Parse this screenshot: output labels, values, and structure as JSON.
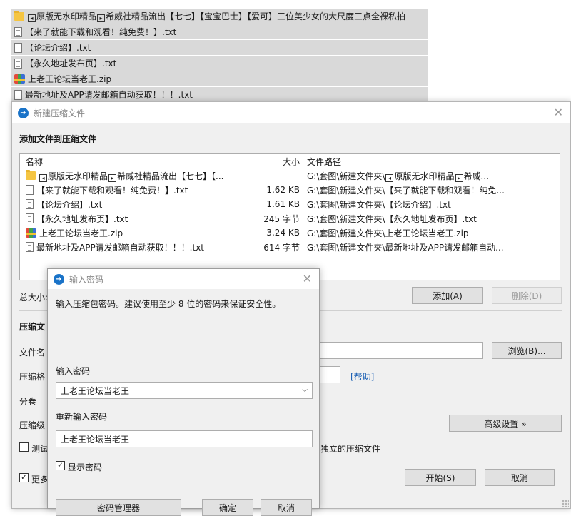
{
  "background_files": [
    {
      "icon": "folder-icon",
      "parts": [
        "",
        "原版无水印精品",
        "希威社精品流出【七七】【宝宝巴士】【爱可】三位美少女的大尺度三点全裸私拍"
      ]
    },
    {
      "icon": "txt-file-icon",
      "name": "【来了就能下载和观看！纯免费！】.txt"
    },
    {
      "icon": "txt-file-icon",
      "name": "【论坛介绍】.txt"
    },
    {
      "icon": "txt-file-icon",
      "name": "【永久地址发布页】.txt"
    },
    {
      "icon": "zip-archive-icon",
      "name": "上老王论坛当老王.zip"
    },
    {
      "icon": "txt-file-icon",
      "name": "最新地址及APP请发邮箱自动获取！！！.txt"
    }
  ],
  "main_dialog": {
    "title": "新建压缩文件",
    "section_title": "添加文件到压缩文件",
    "columns": {
      "name": "名称",
      "size": "大小",
      "path": "文件路径"
    },
    "files": [
      {
        "icon": "folder-icon",
        "name_parts": [
          "原版无水印精品",
          "希威社精品流出【七七】【..."
        ],
        "size": "",
        "path_parts": [
          "G:\\套图\\新建文件夹\\",
          "原版无水印精品",
          "希威..."
        ]
      },
      {
        "icon": "txt-file-icon",
        "name": "【来了就能下载和观看！纯免费！】.txt",
        "size": "1.62 KB",
        "path": "G:\\套图\\新建文件夹\\【来了就能下载和观看！纯免..."
      },
      {
        "icon": "txt-file-icon",
        "name": "【论坛介绍】.txt",
        "size": "1.61 KB",
        "path": "G:\\套图\\新建文件夹\\【论坛介绍】.txt"
      },
      {
        "icon": "txt-file-icon",
        "name": "【永久地址发布页】.txt",
        "size": "245 字节",
        "path": "G:\\套图\\新建文件夹\\【永久地址发布页】.txt"
      },
      {
        "icon": "zip-archive-icon",
        "name": "上老王论坛当老王.zip",
        "size": "3.24 KB",
        "path": "G:\\套图\\新建文件夹\\上老王论坛当老王.zip"
      },
      {
        "icon": "txt-file-icon",
        "name": "最新地址及APP请发邮箱自动获取！！！.txt",
        "size": "614 字节",
        "path": "G:\\套图\\新建文件夹\\最新地址及APP请发邮箱自动..."
      }
    ],
    "total_size_label": "总大小:",
    "add_button": "添加(A)",
    "delete_button": "删除(D)",
    "archive_section_label": "压缩文",
    "filename_label": "文件名",
    "browse_button": "浏览(B)...",
    "format_label": "压缩格",
    "help_link": "[帮助]",
    "volume_label": "分卷",
    "level_label": "压缩级",
    "advanced_button": "高级设置 »",
    "test_checkbox_label": "测试",
    "separate_archive_text": "独立的压缩文件",
    "more_checkbox_label": "更多",
    "start_button": "开始(S)",
    "cancel_button": "取消"
  },
  "password_dialog": {
    "title": "输入密码",
    "instruction": "输入压缩包密码。建议使用至少 8 位的密码来保证安全性。",
    "password_label": "输入密码",
    "password_value": "上老王论坛当老王",
    "reenter_label": "重新输入密码",
    "reenter_value": "上老王论坛当老王",
    "show_password_label": "显示密码",
    "manager_button": "密码管理器",
    "ok_button": "确定",
    "cancel_button": "取消"
  }
}
